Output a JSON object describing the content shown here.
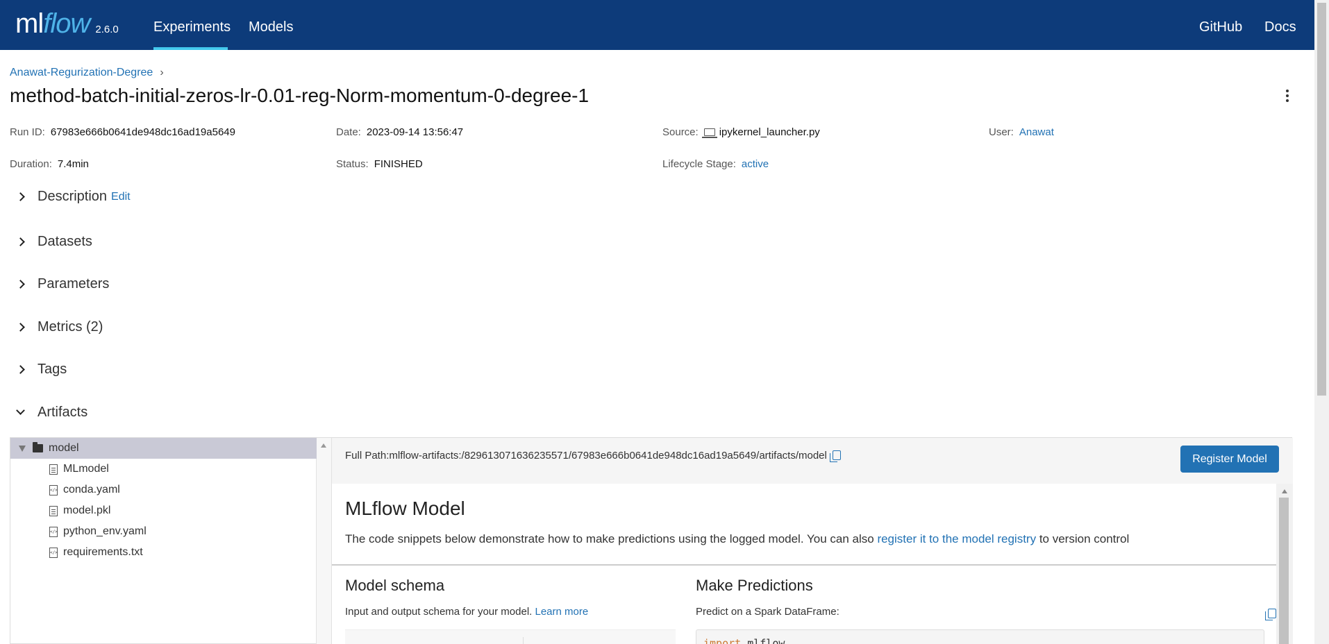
{
  "header": {
    "logo_ml": "ml",
    "logo_flow": "flow",
    "version": "2.6.0",
    "nav": [
      {
        "label": "Experiments",
        "active": true
      },
      {
        "label": "Models",
        "active": false
      }
    ],
    "right_links": [
      "GitHub",
      "Docs"
    ],
    "brand_color": "#0d3b7a",
    "accent_color": "#43c9ed"
  },
  "breadcrumb": {
    "experiment": "Anawat-Regurization-Degree",
    "separator": "›"
  },
  "run": {
    "title": "method-batch-initial-zeros-lr-0.01-reg-Norm-momentum-0-degree-1",
    "run_id_label": "Run ID:",
    "run_id": "67983e666b0641de948dc16ad19a5649",
    "date_label": "Date:",
    "date": "2023-09-14 13:56:47",
    "source_label": "Source:",
    "source": "ipykernel_launcher.py",
    "user_label": "User:",
    "user": "Anawat",
    "duration_label": "Duration:",
    "duration": "7.4min",
    "status_label": "Status:",
    "status": "FINISHED",
    "lifecycle_label": "Lifecycle Stage:",
    "lifecycle": "active"
  },
  "sections": {
    "description": "Description",
    "edit": "Edit",
    "datasets": "Datasets",
    "parameters": "Parameters",
    "metrics": "Metrics (2)",
    "tags": "Tags",
    "artifacts": "Artifacts"
  },
  "artifacts": {
    "tree": [
      {
        "name": "model",
        "type": "folder",
        "selected": true
      },
      {
        "name": "MLmodel",
        "type": "file"
      },
      {
        "name": "conda.yaml",
        "type": "code"
      },
      {
        "name": "model.pkl",
        "type": "file"
      },
      {
        "name": "python_env.yaml",
        "type": "code"
      },
      {
        "name": "requirements.txt",
        "type": "code"
      }
    ],
    "full_path": "Full Path:mlflow-artifacts:/829613071636235571/67983e666b0641de948dc16ad19a5649/artifacts/model",
    "register_button": "Register Model",
    "model_title": "MLflow Model",
    "model_desc_prefix": "The code snippets below demonstrate how to make predictions using the logged model. You can also ",
    "model_desc_link": "register it to the model registry",
    "model_desc_suffix": " to version control",
    "schema_title": "Model schema",
    "schema_desc": "Input and output schema for your model. ",
    "schema_link": "Learn more",
    "pred_title": "Make Predictions",
    "pred_desc": "Predict on a Spark DataFrame:",
    "code_keyword": "import",
    "code_rest": " mlflow"
  }
}
